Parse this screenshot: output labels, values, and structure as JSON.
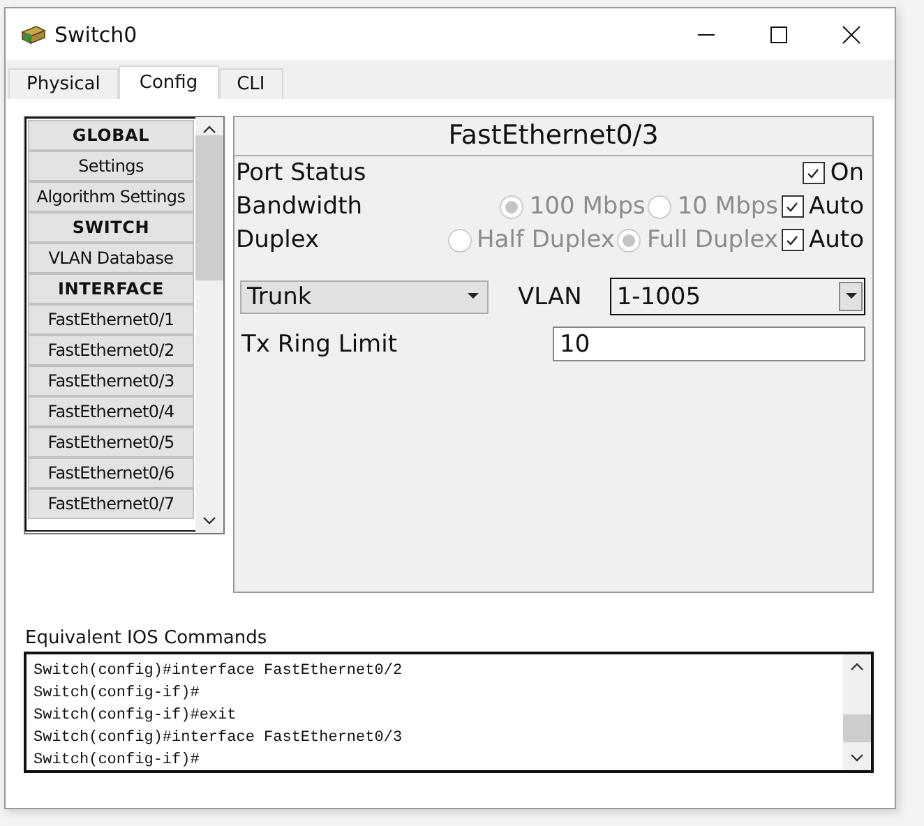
{
  "window": {
    "title": "Switch0"
  },
  "tabs": [
    {
      "label": "Physical",
      "selected": false
    },
    {
      "label": "Config",
      "selected": true
    },
    {
      "label": "CLI",
      "selected": false
    }
  ],
  "sidebar": {
    "items": [
      {
        "label": "GLOBAL",
        "kind": "header"
      },
      {
        "label": "Settings",
        "kind": "item"
      },
      {
        "label": "Algorithm Settings",
        "kind": "item"
      },
      {
        "label": "SWITCH",
        "kind": "header"
      },
      {
        "label": "VLAN Database",
        "kind": "item"
      },
      {
        "label": "INTERFACE",
        "kind": "header"
      },
      {
        "label": "FastEthernet0/1",
        "kind": "item"
      },
      {
        "label": "FastEthernet0/2",
        "kind": "item"
      },
      {
        "label": "FastEthernet0/3",
        "kind": "item"
      },
      {
        "label": "FastEthernet0/4",
        "kind": "item"
      },
      {
        "label": "FastEthernet0/5",
        "kind": "item"
      },
      {
        "label": "FastEthernet0/6",
        "kind": "item"
      },
      {
        "label": "FastEthernet0/7",
        "kind": "item"
      }
    ]
  },
  "panel": {
    "title": "FastEthernet0/3",
    "port_status": {
      "label": "Port Status",
      "toggle": {
        "label": "On",
        "checked": true
      }
    },
    "settings": [
      {
        "label": "Bandwidth",
        "disabled": true,
        "options": [
          {
            "label": "100 Mbps",
            "selected": true
          },
          {
            "label": "10 Mbps",
            "selected": false
          }
        ],
        "auto": {
          "label": "Auto",
          "checked": true
        }
      },
      {
        "label": "Duplex",
        "disabled": true,
        "options": [
          {
            "label": "Half Duplex",
            "selected": false
          },
          {
            "label": "Full Duplex",
            "selected": true
          }
        ],
        "auto": {
          "label": "Auto",
          "checked": true
        }
      }
    ],
    "mode": {
      "value": "Trunk"
    },
    "vlan": {
      "label": "VLAN",
      "value": "1-1005"
    },
    "tx_ring_limit": {
      "label": "Tx Ring Limit",
      "value": "10"
    }
  },
  "console": {
    "label": "Equivalent IOS Commands",
    "lines": [
      "Switch(config)#interface FastEthernet0/2",
      "Switch(config-if)#",
      "Switch(config-if)#exit",
      "Switch(config)#interface FastEthernet0/3",
      "Switch(config-if)#"
    ]
  }
}
